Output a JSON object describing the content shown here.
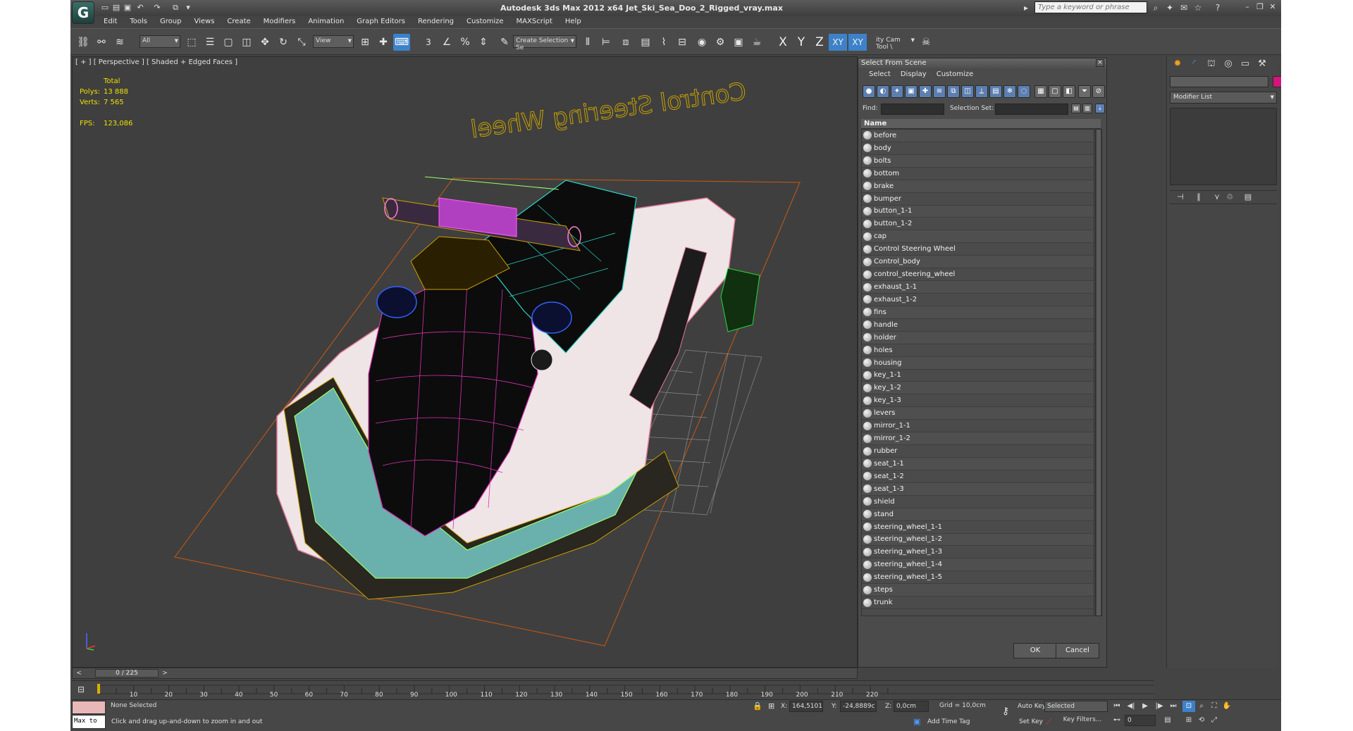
{
  "app": {
    "title": "Autodesk 3ds Max  2012 x64     Jet_Ski_Sea_Doo_2_Rigged_vray.max",
    "search_placeholder": "Type a keyword or phrase",
    "logo": "G"
  },
  "menu": [
    "Edit",
    "Tools",
    "Group",
    "Views",
    "Create",
    "Modifiers",
    "Animation",
    "Graph Editors",
    "Rendering",
    "Customize",
    "MAXScript",
    "Help"
  ],
  "toolbar": {
    "filter_value": "All",
    "coord_value": "View",
    "selection_set_placeholder": "Create Selection Se",
    "snap_label": "3",
    "cam_tool": "ity Cam Tool \\",
    "axes": [
      "X",
      "Y",
      "Z",
      "XY",
      "XY"
    ]
  },
  "viewport": {
    "label": "[ + ] [ Perspective ] [ Shaded + Edged Faces ]",
    "stats_header": "Total",
    "polys_label": "Polys:",
    "polys_value": "13 888",
    "verts_label": "Verts:",
    "verts_value": "7 565",
    "fps_label": "FPS:",
    "fps_value": "123,086",
    "scene_text": "Control Steering Wheel"
  },
  "select_dialog": {
    "title": "Select From Scene",
    "menu": [
      "Select",
      "Display",
      "Customize"
    ],
    "find_label": "Find:",
    "selection_set_label": "Selection Set:",
    "column_name": "Name",
    "objects": [
      "before",
      "body",
      "bolts",
      "bottom",
      "brake",
      "bumper",
      "button_1-1",
      "button_1-2",
      "cap",
      "Control Steering Wheel",
      "Control_body",
      "control_steering_wheel",
      "exhaust_1-1",
      "exhaust_1-2",
      "fins",
      "handle",
      "holder",
      "holes",
      "housing",
      "key_1-1",
      "key_1-2",
      "key_1-3",
      "levers",
      "mirror_1-1",
      "mirror_1-2",
      "rubber",
      "seat_1-1",
      "seat_1-2",
      "seat_1-3",
      "shield",
      "stand",
      "steering_wheel_1-1",
      "steering_wheel_1-2",
      "steering_wheel_1-3",
      "steering_wheel_1-4",
      "steering_wheel_1-5",
      "steps",
      "trunk"
    ],
    "ok_label": "OK",
    "cancel_label": "Cancel"
  },
  "command_panel": {
    "modifier_list": "Modifier List",
    "object_color": "#d4147a"
  },
  "timeline": {
    "frame_counter": "0 / 225",
    "ticks": [
      "10",
      "20",
      "30",
      "40",
      "50",
      "60",
      "70",
      "80",
      "90",
      "100",
      "110",
      "120",
      "130",
      "140",
      "150",
      "160",
      "170",
      "180",
      "190",
      "200",
      "210",
      "220"
    ]
  },
  "status": {
    "selection": "None Selected",
    "prompt": "Click and drag up-and-down to zoom in and out",
    "maxscript": "Max to",
    "x_label": "X:",
    "x_value": "164,5101c",
    "y_label": "Y:",
    "y_value": "-24,8889c",
    "z_label": "Z:",
    "z_value": "0,0cm",
    "grid": "Grid = 10,0cm",
    "add_time_tag": "Add Time Tag",
    "auto_key": "Auto Key",
    "set_key": "Set Key",
    "key_mode": "Selected",
    "key_filters": "Key Filters...",
    "frame": "0"
  }
}
